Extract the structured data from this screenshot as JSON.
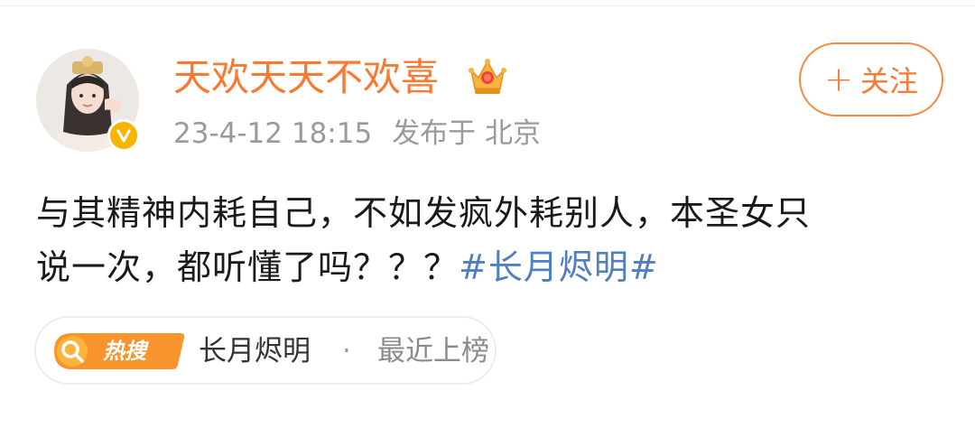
{
  "post": {
    "author": {
      "name": "天欢天天不欢喜",
      "avatar_icon": "avatar-portrait",
      "verified_icon": "verified-badge-icon",
      "vip_icon": "vip-crown-icon"
    },
    "timestamp": "23-4-12 18:15",
    "location": "发布于 北京",
    "follow_button": {
      "plus": "+",
      "label": "关注"
    },
    "text": {
      "line1": "与其精神内耗自己，不如发疯外耗别人，本圣女只",
      "line2_plain": "说一次，都听懂了吗？？？",
      "hashtag": "#长月烬明#"
    },
    "trend": {
      "tag_label": "热搜",
      "topic": "长月烬明",
      "separator": "·",
      "status": "最近上榜"
    }
  },
  "colors": {
    "accent_orange": "#f8792f",
    "hashtag_blue": "#4f7fc1",
    "meta_gray": "#9a9a9a",
    "badge_yellow": "#f7b500"
  }
}
